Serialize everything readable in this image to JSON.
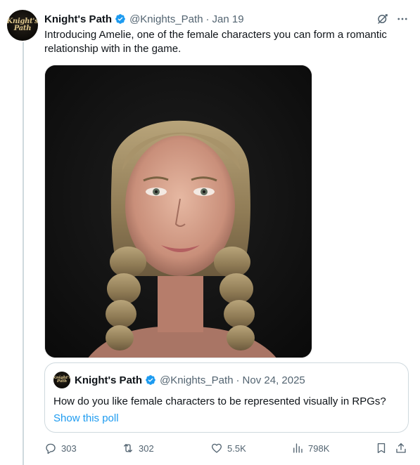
{
  "tweet": {
    "author_name": "Knight's Path",
    "handle": "@Knights_Path",
    "date": "Jan 19",
    "text": "Introducing Amelie, one of the female characters you can form a romantic relationship with in the game.",
    "avatar_text": "Knight's Path"
  },
  "quote": {
    "author_name": "Knight's Path",
    "handle": "@Knights_Path",
    "date": "Nov 24, 2025",
    "text": "How do you like female characters to be represented visually in RPGs?",
    "link": "Show this poll",
    "avatar_text": "Knight's Path"
  },
  "actions": {
    "replies": "303",
    "reposts": "302",
    "likes": "5.5K",
    "views": "798K"
  },
  "colors": {
    "link": "#1d9bf0",
    "muted": "#536471",
    "text": "#0f1419",
    "border": "#cfd9de"
  },
  "icons": {
    "verified": "verified-badge-icon",
    "grok": "grok-icon",
    "more": "more-icon",
    "reply": "reply-icon",
    "repost": "repost-icon",
    "like": "heart-icon",
    "views": "views-icon",
    "bookmark": "bookmark-icon",
    "share": "share-icon"
  }
}
